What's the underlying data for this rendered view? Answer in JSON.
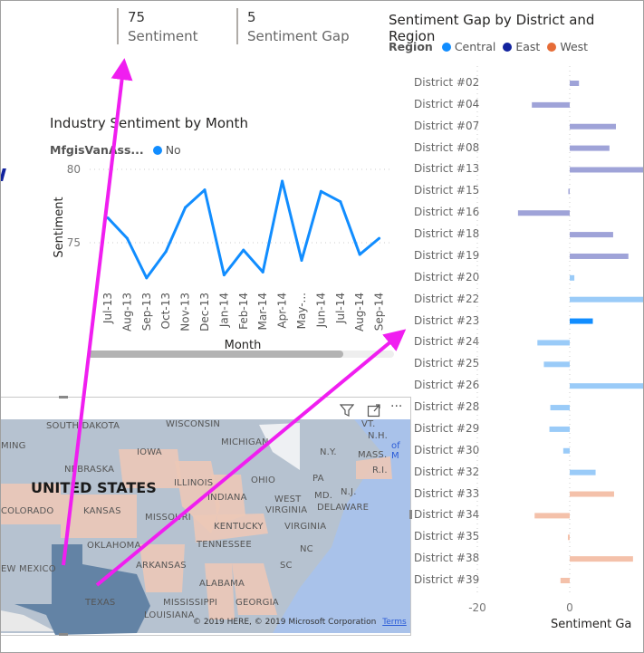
{
  "cards": [
    {
      "value": "75",
      "label": "Sentiment"
    },
    {
      "value": "5",
      "label": "Sentiment Gap"
    }
  ],
  "line_chart": {
    "title": "Industry Sentiment by Month",
    "legend_title": "MfgisVanAss...",
    "legend_item": "No",
    "color": "#118DFF"
  },
  "bar_chart": {
    "title": "Sentiment Gap by District and Region",
    "legend_title": "Region",
    "xlabel": "Sentiment Ga"
  },
  "map": {
    "country_label": "UNITED STATES",
    "states": [
      "SOUTH DAKOTA",
      "WISCONSIN",
      "MICHIGAN",
      "VT.",
      "N.H.",
      "MING",
      "IOWA",
      "N.Y.",
      "MASS.",
      "NEBRASKA",
      "R.I.",
      "ILLINOIS",
      "OHIO",
      "PA",
      "INDIANA",
      "WEST",
      "VIRGINIA",
      "MD.",
      "N.J.",
      "DELAWARE",
      "COLORADO",
      "KANSAS",
      "MISSOURI",
      "KENTUCKY",
      "VIRGINIA",
      "OKLAHOMA",
      "TENNESSEE",
      "NC",
      "EW MEXICO",
      "ARKANSAS",
      "SC",
      "ALABAMA",
      "TEXAS",
      "MISSISSIPPI",
      "GEORGIA",
      "LOUISIANA"
    ],
    "copyright": "© 2019 HERE, © 2019 Microsoft Corporation",
    "terms": "Terms",
    "sea_label": "of M",
    "icons": [
      "filter-icon",
      "focus-mode-icon",
      "more-options-icon"
    ],
    "more_label": "···"
  },
  "chart_data": [
    {
      "type": "line",
      "title": "Industry Sentiment by Month",
      "xlabel": "Month",
      "ylabel": "Sentiment",
      "categories": [
        "Jul-13",
        "Aug-13",
        "Sep-13",
        "Oct-13",
        "Nov-13",
        "Dec-13",
        "Jan-14",
        "Feb-14",
        "Mar-14",
        "Apr-14",
        "May-...",
        "Jun-14",
        "Jul-14",
        "Aug-14",
        "Sep-14"
      ],
      "series": [
        {
          "name": "No",
          "values": [
            76.7,
            75.3,
            72.6,
            74.4,
            77.4,
            78.6,
            72.8,
            74.5,
            73.0,
            79.2,
            73.8,
            78.5,
            77.8,
            74.2,
            75.3
          ]
        }
      ],
      "yticks": [
        75,
        80
      ],
      "ylim": [
        72,
        80.5
      ],
      "grid": true
    },
    {
      "type": "bar",
      "orientation": "horizontal",
      "title": "Sentiment Gap by District and Region",
      "xlabel": "Sentiment Ga",
      "xticks": [
        -20,
        0
      ],
      "legend": [
        {
          "name": "Central",
          "color": "#118DFF"
        },
        {
          "name": "East",
          "color": "#12239E"
        },
        {
          "name": "West",
          "color": "#E66C37"
        }
      ],
      "faded_colors": {
        "Central": "#9ACBF8",
        "East": "#9FA3D8",
        "West": "#F4C1AA"
      },
      "highlighted": "District #23",
      "categories": [
        "District #02",
        "District #04",
        "District #07",
        "District #08",
        "District #13",
        "District #15",
        "District #16",
        "District #18",
        "District #19",
        "District #20",
        "District #22",
        "District #23",
        "District #24",
        "District #25",
        "District #26",
        "District #28",
        "District #29",
        "District #30",
        "District #32",
        "District #33",
        "District #34",
        "District #35",
        "District #38",
        "District #39"
      ],
      "regions": [
        "East",
        "East",
        "East",
        "East",
        "East",
        "East",
        "East",
        "East",
        "East",
        "Central",
        "Central",
        "Central",
        "Central",
        "Central",
        "Central",
        "Central",
        "Central",
        "Central",
        "Central",
        "West",
        "West",
        "West",
        "West",
        "West"
      ],
      "values": [
        2,
        -8.2,
        10,
        8.6,
        17,
        -0.3,
        -11.2,
        9.4,
        12.7,
        1,
        16,
        5,
        -7,
        -5.6,
        17,
        -4.2,
        -4.4,
        -1.4,
        5.6,
        9.6,
        -7.6,
        -0.4,
        13.7,
        -2
      ]
    }
  ]
}
